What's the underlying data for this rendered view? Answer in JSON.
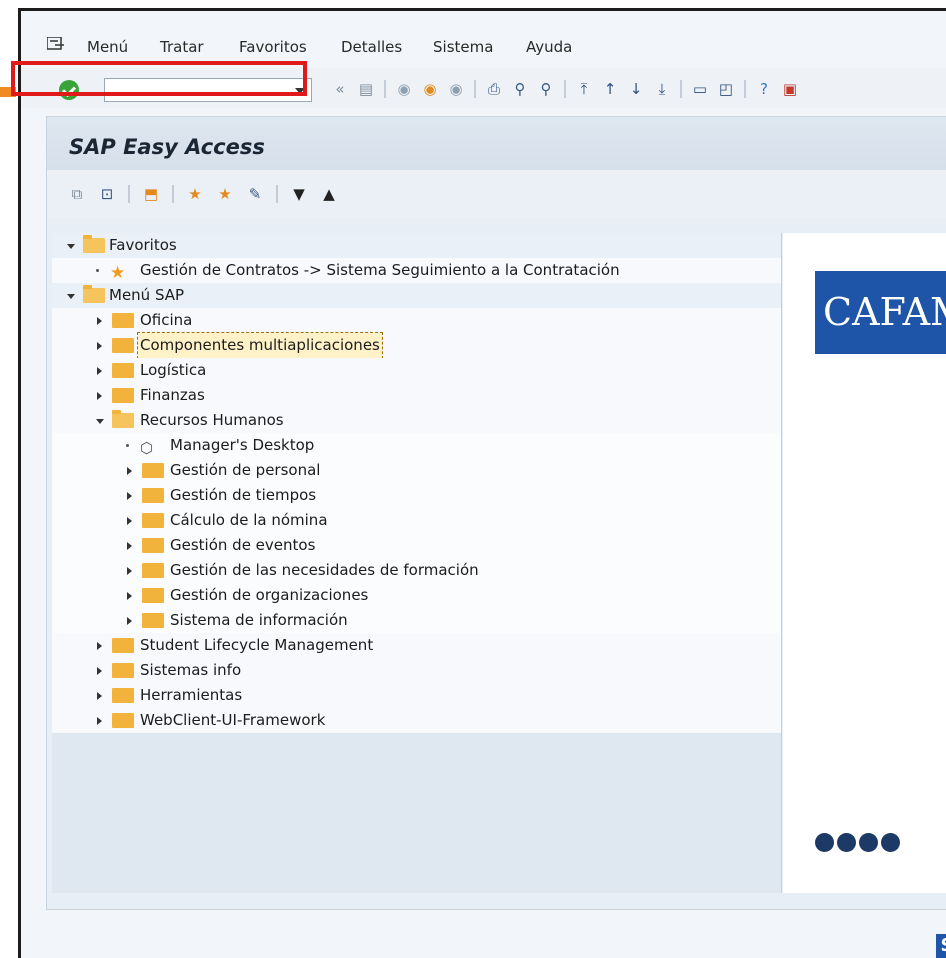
{
  "menubar": {
    "items": [
      "Menú",
      "Tratar",
      "Favoritos",
      "Detalles",
      "Sistema",
      "Ayuda"
    ]
  },
  "toolbar": {
    "command_field_value": "",
    "icons": [
      "back-double-arrow-icon",
      "save-icon",
      "back-icon",
      "exit-icon",
      "cancel-icon",
      "print-icon",
      "find-icon",
      "find-next-icon",
      "first-page-icon",
      "previous-page-icon",
      "next-page-icon",
      "last-page-icon",
      "create-session-icon",
      "shortcut-icon",
      "help-icon",
      "customize-layout-icon"
    ]
  },
  "panel": {
    "title": "SAP Easy Access"
  },
  "tree": {
    "favoritos": "Favoritos",
    "fav_item": "Gestión de Contratos -> Sistema Seguimiento a la Contratación",
    "menu_sap": "Menú SAP",
    "oficina": "Oficina",
    "componentes": "Componentes multiaplicaciones",
    "logistica": "Logística",
    "finanzas": "Finanzas",
    "rrhh": "Recursos Humanos",
    "managers_desktop": "Manager's Desktop",
    "gestion_personal": "Gestión de personal",
    "gestion_tiempos": "Gestión de tiempos",
    "calculo_nomina": "Cálculo de la nómina",
    "gestion_eventos": "Gestión de eventos",
    "gestion_formacion": "Gestión de las necesidades de formación",
    "gestion_organizaciones": "Gestión de organizaciones",
    "sistema_informacion": "Sistema de información",
    "student_lifecycle": "Student Lifecycle Management",
    "sistemas_info": "Sistemas info",
    "herramientas": "Herramientas",
    "webclient": "WebClient-UI-Framework"
  },
  "logo": {
    "text": "CAFAM"
  },
  "footer": {
    "sap_badge": "S"
  },
  "colors": {
    "highlight_border": "#e01a1a",
    "pointer_arrow": "#f08a24",
    "folder": "#f2b33d",
    "logo_bg": "#1f55a8"
  }
}
